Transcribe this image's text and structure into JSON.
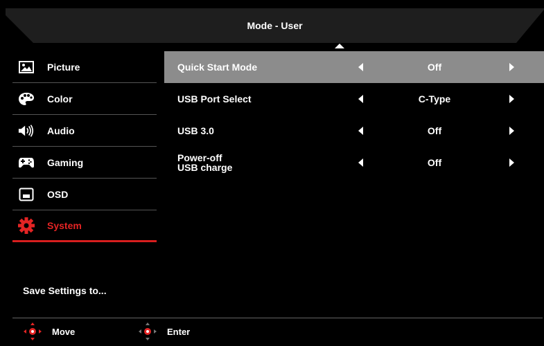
{
  "header": {
    "title": "Mode - User"
  },
  "sidebar": {
    "items": [
      {
        "label": "Picture",
        "icon": "picture-icon"
      },
      {
        "label": "Color",
        "icon": "palette-icon"
      },
      {
        "label": "Audio",
        "icon": "speaker-icon"
      },
      {
        "label": "Gaming",
        "icon": "gamepad-icon"
      },
      {
        "label": "OSD",
        "icon": "osd-icon"
      },
      {
        "label": "System",
        "icon": "gear-icon",
        "active": true
      }
    ],
    "save_settings": "Save Settings to..."
  },
  "settings": [
    {
      "name": "Quick Start Mode",
      "value": "Off",
      "selected": true
    },
    {
      "name": "USB Port Select",
      "value": "C-Type"
    },
    {
      "name": "USB 3.0",
      "value": "Off"
    },
    {
      "name": "Power-off\nUSB charge",
      "name_line1": "Power-off",
      "name_line2": "USB charge",
      "value": "Off"
    }
  ],
  "footer": {
    "move_label": "Move",
    "enter_label": "Enter"
  },
  "colors": {
    "accent": "#e42424",
    "selected_row": "#8c8c8c",
    "header_bg": "#1e1e1e"
  }
}
